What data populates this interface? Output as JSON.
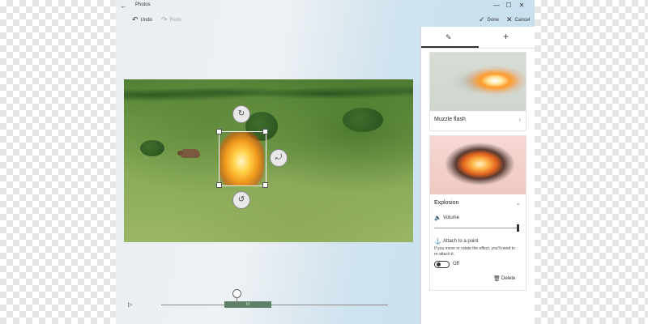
{
  "app": {
    "title": "Photos"
  },
  "commands": {
    "undo_label": "Undo",
    "redo_label": "Redo",
    "done_label": "Done",
    "cancel_label": "Cancel"
  },
  "timeline": {
    "clip_label": "III"
  },
  "panel": {
    "tabs": [
      {
        "name": "edit",
        "icon": "pencil-icon",
        "selected": true
      },
      {
        "name": "add",
        "icon": "plus-icon",
        "selected": false
      }
    ],
    "effects": [
      {
        "title": "Muzzle flash",
        "expanded": false
      },
      {
        "title": "Explosion",
        "expanded": true,
        "volume_label": "Volume",
        "volume_level": 1.0,
        "attach_label": "Attach to a point",
        "attach_help": "If you move or rotate the effect, you'll need to re-attach it.",
        "toggle_state": "Off",
        "delete_label": "Delete"
      }
    ]
  },
  "icons": {
    "back": "←",
    "minimize": "—",
    "maximize": "☐",
    "close": "✕",
    "undo": "↶",
    "redo": "↷",
    "check": "✓",
    "cancel": "✕",
    "pencil": "✎",
    "plus": "+",
    "chevron_right": "›",
    "chevron_down": "⌄",
    "speaker": "🔈",
    "anchor": "⚓",
    "trash": "🗑",
    "rotate_top": "↻",
    "rotate_right": "⤾",
    "rotate_bottom": "↺",
    "play": "▷"
  },
  "colors": {
    "clip": "#5f8068",
    "panel_bg": "#ffffff",
    "window_bg": "#dfe9f0"
  }
}
